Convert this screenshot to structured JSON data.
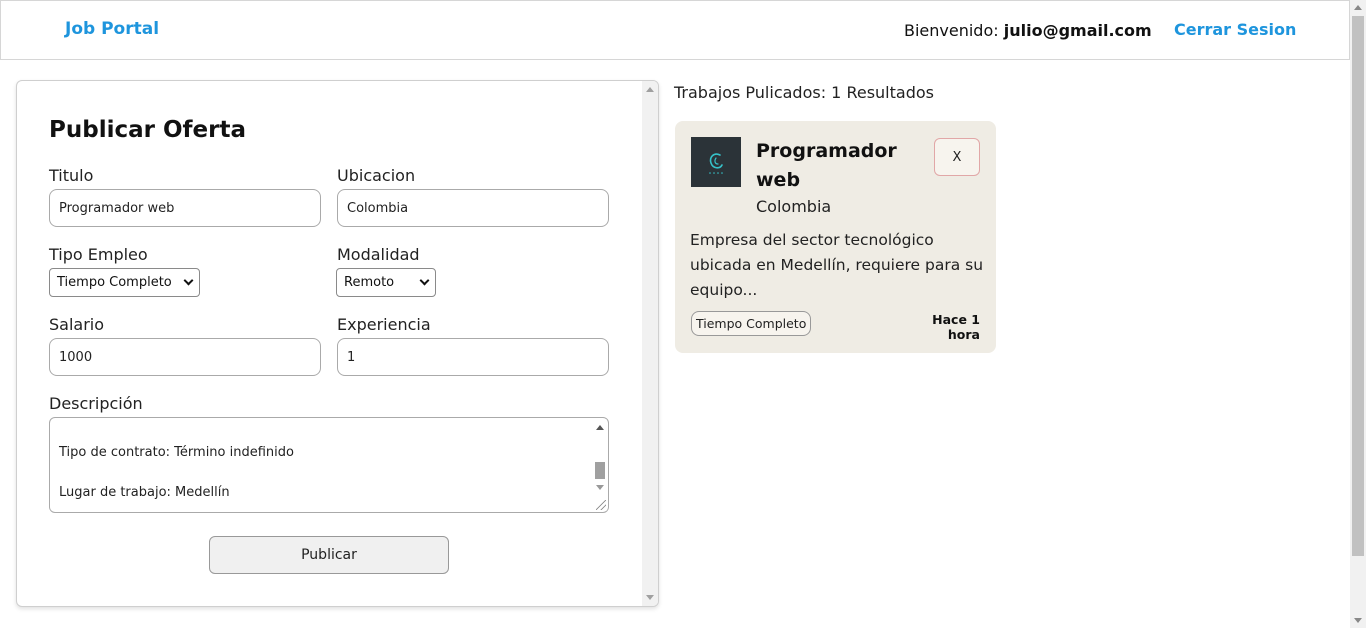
{
  "header": {
    "brand": "Job Portal",
    "welcome_label": "Bienvenido:",
    "user_email": "julio@gmail.com",
    "logout_label": "Cerrar Sesion",
    "accent_color": "#1e95dd"
  },
  "form": {
    "title": "Publicar Oferta",
    "fields": {
      "titulo": {
        "label": "Titulo",
        "value": "Programador web"
      },
      "ubicacion": {
        "label": "Ubicacion",
        "value": "Colombia"
      },
      "tipo_empleo": {
        "label": "Tipo Empleo",
        "selected": "Tiempo Completo"
      },
      "modalidad": {
        "label": "Modalidad",
        "selected": "Remoto"
      },
      "salario": {
        "label": "Salario",
        "value": "1000"
      },
      "experiencia": {
        "label": "Experiencia",
        "value": "1"
      },
      "descripcion": {
        "label": "Descripción",
        "visible_lines": [
          "Tipo de contrato: Término indefinido",
          "Lugar de trabajo: Medellín"
        ]
      }
    },
    "submit_label": "Publicar"
  },
  "results": {
    "summary": "Trabajos Pulicados: 1 Resultados",
    "jobs": [
      {
        "title": "Programador web",
        "location": "Colombia",
        "description": "Empresa del sector tecnológico ubicada en Medellín, requiere para su equipo...",
        "type_badge": "Tiempo Completo",
        "posted": "Hace 1 hora",
        "delete_label": "X",
        "logo_icon": "company-logo-icon",
        "card_color": "#efece4"
      }
    ]
  }
}
